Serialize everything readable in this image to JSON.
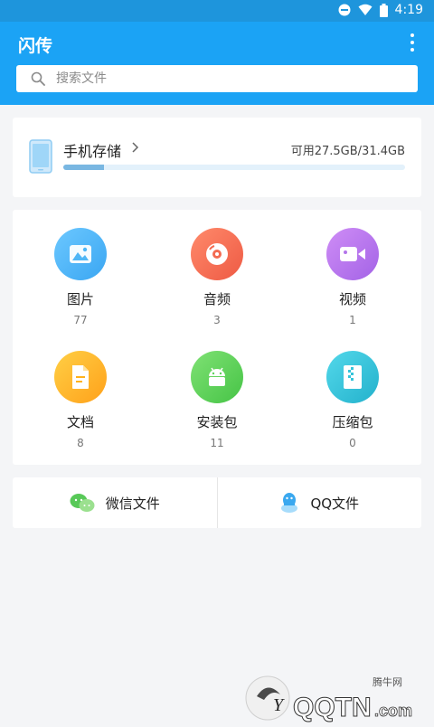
{
  "status_bar": {
    "time": "4:19"
  },
  "app_bar": {
    "title": "闪传",
    "menu_icon": "more-vert-icon"
  },
  "search": {
    "placeholder": "搜索文件",
    "value": ""
  },
  "storage": {
    "title": "手机存储",
    "available_text": "可用27.5GB/31.4GB",
    "used_fraction": 0.12
  },
  "categories": [
    {
      "label": "图片",
      "count": "77",
      "icon": "image-icon",
      "color": "#4fb6f6"
    },
    {
      "label": "音频",
      "count": "3",
      "icon": "music-disc-icon",
      "color": "#f36b52"
    },
    {
      "label": "视频",
      "count": "1",
      "icon": "video-camera-icon",
      "color": "#b374ea"
    },
    {
      "label": "文档",
      "count": "8",
      "icon": "document-icon",
      "color": "#ffb21c"
    },
    {
      "label": "安装包",
      "count": "11",
      "icon": "android-icon",
      "color": "#5ed25c"
    },
    {
      "label": "压缩包",
      "count": "0",
      "icon": "zip-archive-icon",
      "color": "#35c4da"
    }
  ],
  "shortcuts": [
    {
      "label": "微信文件",
      "icon": "wechat-icon"
    },
    {
      "label": "QQ文件",
      "icon": "qq-icon"
    }
  ],
  "watermark": {
    "site": "腾牛网",
    "brand": "QQTN",
    "suffix": ".com"
  }
}
